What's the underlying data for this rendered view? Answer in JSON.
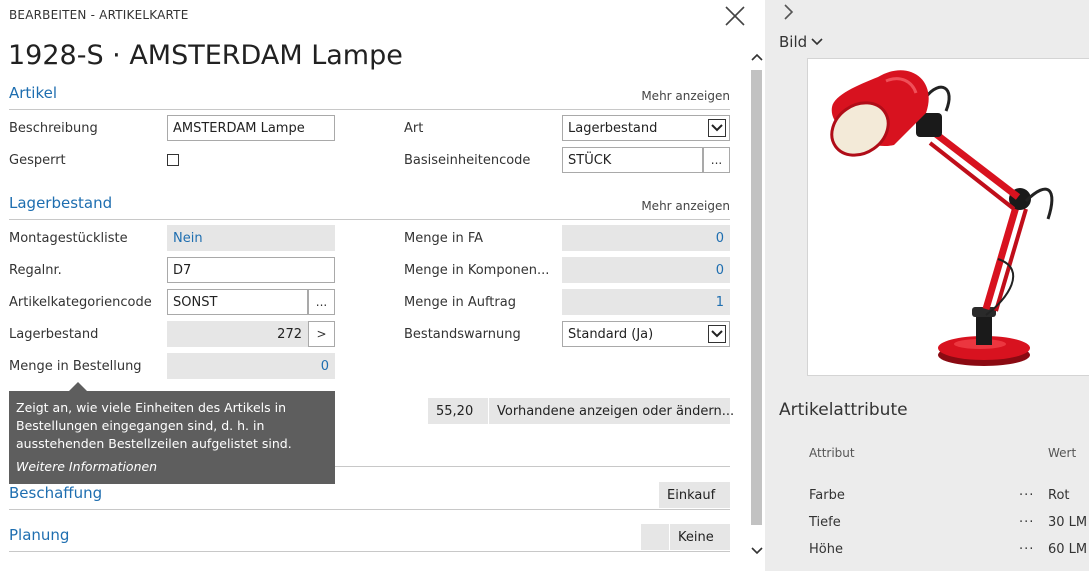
{
  "header": {
    "breadcrumb": "BEARBEITEN - ARTIKELKARTE",
    "title": "1928-S · AMSTERDAM Lampe"
  },
  "sections": {
    "artikel": {
      "title": "Artikel",
      "more": "Mehr anzeigen"
    },
    "lagerbestand": {
      "title": "Lagerbestand",
      "more": "Mehr anzeigen"
    },
    "beschaffung": {
      "title": "Beschaffung",
      "value": "Einkauf"
    },
    "planung": {
      "title": "Planung",
      "value": "Keine"
    }
  },
  "artikel_fields": {
    "beschreibung_label": "Beschreibung",
    "beschreibung_value": "AMSTERDAM Lampe",
    "gesperrt_label": "Gesperrt",
    "gesperrt_checked": false,
    "art_label": "Art",
    "art_value": "Lagerbestand",
    "basis_label": "Basiseinheitencode",
    "basis_value": "STÜCK",
    "basis_btn": "..."
  },
  "lager_fields": {
    "montage_label": "Montagestückliste",
    "montage_value": "Nein",
    "regal_label": "Regalnr.",
    "regal_value": "D7",
    "kat_label": "Artikelkategoriencode",
    "kat_value": "SONST",
    "kat_btn": "...",
    "lager_label": "Lagerbestand",
    "lager_value": "272",
    "lager_btn": ">",
    "bestellung_label": "Menge in Bestellung",
    "bestellung_value": "0",
    "fa_label": "Menge in FA",
    "fa_value": "0",
    "komp_label": "Menge in Komponen...",
    "komp_value": "0",
    "auftrag_label": "Menge in Auftrag",
    "auftrag_value": "1",
    "warnung_label": "Bestandswarnung",
    "warnung_value": "Standard (Ja)"
  },
  "price_row": {
    "value": "55,20",
    "action": "Vorhandene anzeigen oder ändern..."
  },
  "tooltip": {
    "text": "Zeigt an, wie viele Einheiten des Artikels in Bestellungen eingegangen sind, d. h. in ausstehenden Bestellzeilen aufgelistet sind.",
    "link": "Weitere Informationen"
  },
  "factbox": {
    "bild_label": "Bild",
    "attr_title": "Artikelattribute",
    "attr_col": "Attribut",
    "value_col": "Wert",
    "attributes": [
      {
        "name": "Farbe",
        "dots": "···",
        "value": "Rot"
      },
      {
        "name": "Tiefe",
        "dots": "···",
        "value": "30 LM"
      },
      {
        "name": "Höhe",
        "dots": "···",
        "value": "60 LM"
      }
    ]
  },
  "colors": {
    "accent": "#1e6eb0",
    "lamp_red": "#d8121f",
    "tooltip_bg": "#5e5e5e",
    "factbox_bg": "#ececec"
  }
}
